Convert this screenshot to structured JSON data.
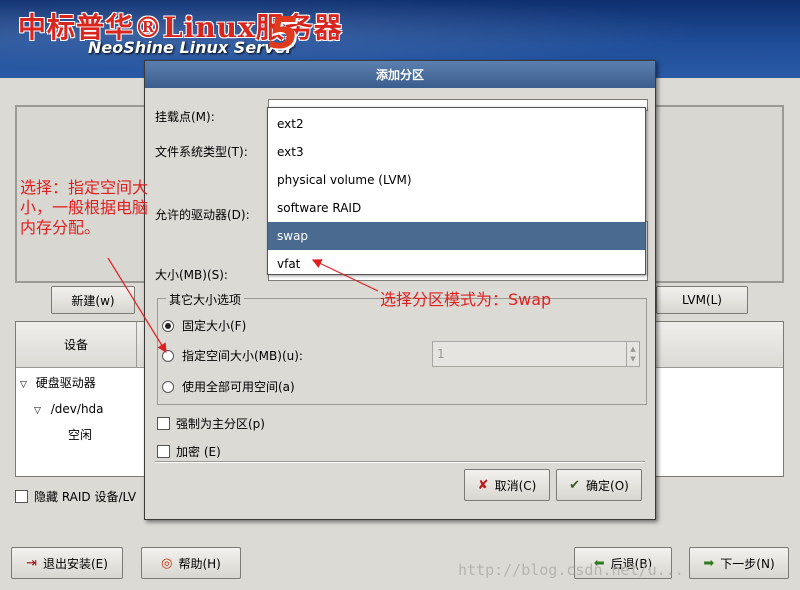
{
  "header": {
    "brand_cn": "中标普华®Linux服务器",
    "brand_en": "NeoShine Linux Server",
    "brand_version": "5"
  },
  "background": {
    "new_button": "新建(w)",
    "lvm_button": "LVM(L)",
    "tree_header_device": "设备",
    "tree_items": [
      "硬盘驱动器",
      "/dev/hda",
      "空闲"
    ],
    "hide_raid_label": "隐藏 RAID 设备/LV",
    "exit_button": "退出安装(E)",
    "help_button": "帮助(H)",
    "back_button": "后退(B)",
    "next_button": "下一步(N)"
  },
  "dialog": {
    "title": "添加分区",
    "mount_point_label": "挂载点(M):",
    "fs_type_label": "文件系统类型(T):",
    "allowed_drives_label": "允许的驱动器(D):",
    "size_label": "大小(MB)(S):",
    "other_size_title": "其它大小选项",
    "radio_fixed": "固定大小(F)",
    "radio_up_to": "指定空间大小(MB)(u):",
    "radio_fill": "使用全部可用空间(a)",
    "up_to_value": "1",
    "force_primary": "强制为主分区(p)",
    "encrypt": "加密 (E)",
    "cancel_button": "取消(C)",
    "ok_button": "确定(O)"
  },
  "fs_dropdown": {
    "options": [
      "ext2",
      "ext3",
      "physical volume (LVM)",
      "software RAID",
      "swap",
      "vfat"
    ],
    "selected": "swap"
  },
  "annotations": {
    "left_note": "选择：指定空间大小，一般根据电脑内存分配。",
    "right_note": "选择分区模式为：Swap",
    "annotation_color": "#e02020"
  },
  "watermark": "http://blog.csdn.net/u...",
  "colors": {
    "header_bg": "#1f4d98",
    "dialog_title_bg": "#3a5d8d",
    "selection_bg": "#4b6a8f",
    "window_bg": "#dcdad5"
  }
}
